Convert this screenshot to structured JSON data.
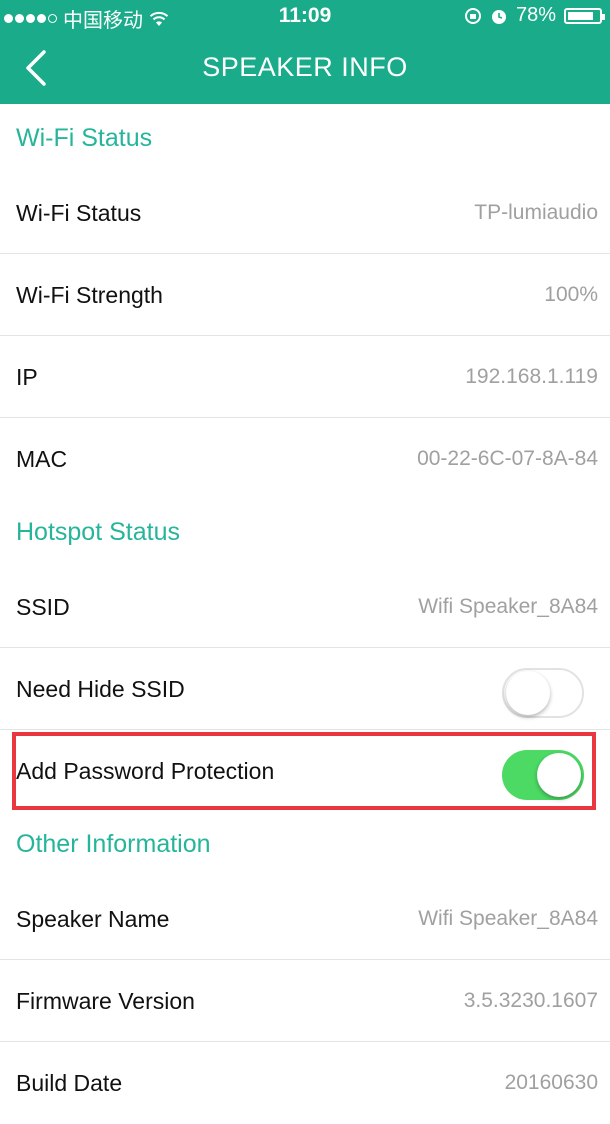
{
  "status_bar": {
    "carrier": "中国移动",
    "time": "11:09",
    "battery": "78%"
  },
  "nav": {
    "title": "SPEAKER INFO"
  },
  "sections": {
    "wifi": {
      "header": "Wi-Fi Status",
      "rows": [
        {
          "label": "Wi-Fi Status",
          "value": "TP-lumiaudio"
        },
        {
          "label": "Wi-Fi Strength",
          "value": "100%"
        },
        {
          "label": "IP",
          "value": "192.168.1.119"
        },
        {
          "label": "MAC",
          "value": "00-22-6C-07-8A-84"
        }
      ]
    },
    "hotspot": {
      "header": "Hotspot Status",
      "ssid": {
        "label": "SSID",
        "value": "Wifi Speaker_8A84"
      },
      "hide_ssid": {
        "label": "Need Hide SSID",
        "on": false
      },
      "password": {
        "label": "Add Password Protection",
        "on": true
      }
    },
    "other": {
      "header": "Other Information",
      "rows": [
        {
          "label": "Speaker Name",
          "value": "Wifi Speaker_8A84"
        },
        {
          "label": "Firmware Version",
          "value": "3.5.3230.1607"
        },
        {
          "label": "Build Date",
          "value": "20160630"
        }
      ]
    }
  },
  "colors": {
    "brand": "#1aac8a",
    "section_text": "#26b59a",
    "toggle_on": "#4cd964",
    "highlight": "#e8373e"
  }
}
